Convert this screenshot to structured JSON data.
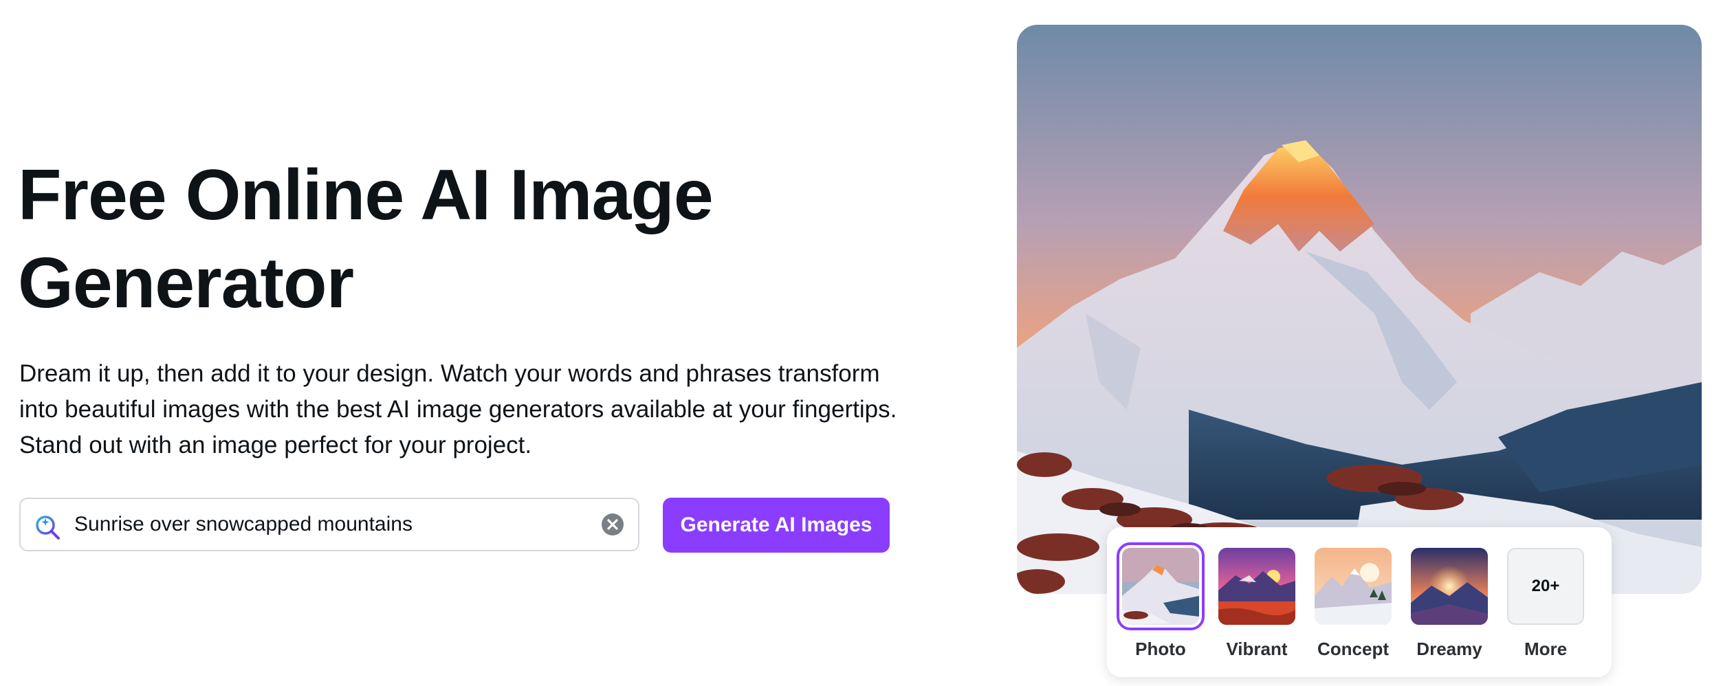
{
  "hero": {
    "title_line1": "Free Online AI Image",
    "title_line2": "Generator",
    "description": "Dream it up, then add it to your design. Watch your words and phrases transform into beautiful images with the best AI image generators available at your fingertips. Stand out with an image perfect for your project."
  },
  "search": {
    "value": "Sunrise over snowcapped mountains",
    "icon": "magic-search-icon",
    "clear_icon": "clear-icon"
  },
  "generate_button": {
    "label": "Generate AI Images"
  },
  "colors": {
    "accent": "#8b3dff",
    "text": "#0e1318"
  },
  "styles": {
    "selected": "Photo",
    "options": [
      {
        "label": "Photo"
      },
      {
        "label": "Vibrant"
      },
      {
        "label": "Concept"
      },
      {
        "label": "Dreamy"
      },
      {
        "label": "More",
        "badge": "20+"
      }
    ]
  }
}
